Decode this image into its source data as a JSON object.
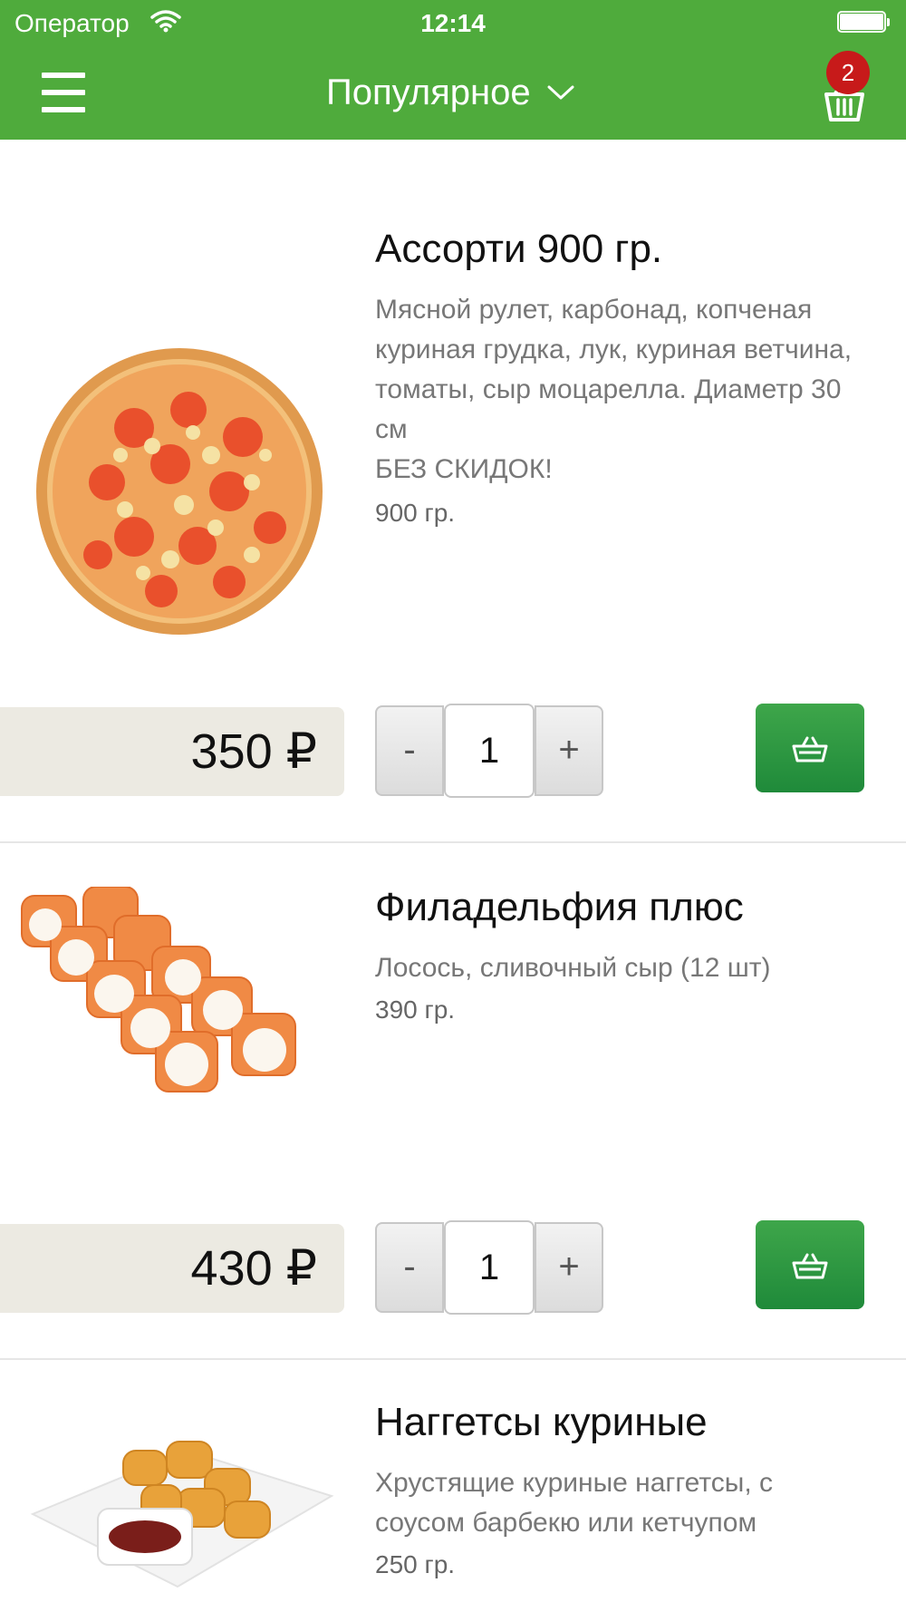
{
  "status_bar": {
    "carrier": "Оператор",
    "time": "12:14",
    "wifi_icon": "wifi-icon",
    "battery_icon": "battery-icon"
  },
  "header": {
    "title": "Популярное",
    "menu_icon": "hamburger-menu-icon",
    "dropdown_icon": "chevron-down-icon",
    "cart_icon": "shopping-basket-icon",
    "cart_count": "2",
    "background_color": "#4fab3c",
    "badge_color": "#c71a1a"
  },
  "products": [
    {
      "name": "Ассорти 900 гр.",
      "description": "Мясной рулет, карбонад, копченая\nкуриная грудка, лук, куриная ветчина,\nтоматы, сыр моцарелла. Диаметр 30\nсм\nБЕЗ СКИДОК!",
      "weight": "900 гр.",
      "price": "350 ₽",
      "quantity": "1",
      "minus_label": "-",
      "plus_label": "+",
      "image": "pizza-image"
    },
    {
      "name": "Филадельфия плюс",
      "description": "Лосось, сливочный сыр (12 шт)",
      "weight": "390 гр.",
      "price": "430 ₽",
      "quantity": "1",
      "minus_label": "-",
      "plus_label": "+",
      "image": "sushi-rolls-image"
    },
    {
      "name": "Наггетсы куриные",
      "description": "Хрустящие куриные наггетсы, с\nсоусом барбекю или кетчупом",
      "weight": "250 гр.",
      "image": "chicken-nuggets-image"
    }
  ],
  "colors": {
    "accent_green": "#2a9a42",
    "price_bg": "#eceae2"
  }
}
